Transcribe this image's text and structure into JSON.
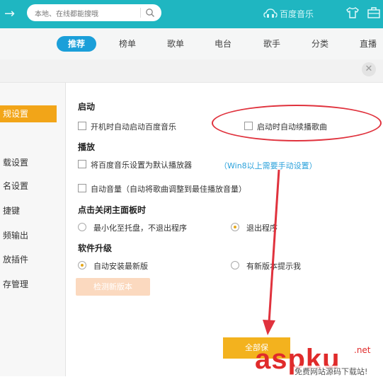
{
  "header": {
    "search_placeholder": "本地、在线都能搜哦",
    "brand": "百度音乐"
  },
  "nav": {
    "tabs": [
      "推荐",
      "榜单",
      "歌单",
      "电台",
      "歌手",
      "分类",
      "直播"
    ],
    "active_tab": "推荐"
  },
  "settings": {
    "sidebar": [
      "规设置",
      "载设置",
      "名设置",
      "捷键",
      "频输出",
      "放插件",
      "存管理"
    ],
    "sidebar_active": "规设置",
    "startup": {
      "title": "启动",
      "auto_start": "开机时自动启动百度音乐",
      "resume_play": "启动时自动续播歌曲"
    },
    "playback": {
      "title": "播放",
      "default_player": "将百度音乐设置为默认播放器",
      "win8_link": "（Win8以上需要手动设置）",
      "auto_volume": "自动音量（自动将歌曲调整到最佳播放音量）"
    },
    "close_panel": {
      "title": "点击关闭主面板时",
      "minimize": "最小化至托盘，不退出程序",
      "exit": "退出程序"
    },
    "upgrade": {
      "title": "软件升级",
      "auto_install": "自动安装最新版",
      "notify_only": "有新版本提示我",
      "check_button": "检测新版本"
    },
    "save_button": "全部保"
  },
  "watermark": {
    "logo": "aspku",
    "tld": ".net",
    "tagline": "免费网站源码下载站!"
  },
  "colors": {
    "topbar": "#1fb6c1",
    "active_tab": "#1b9fd9",
    "accent": "#f2a518",
    "annotation": "#e0323d"
  }
}
